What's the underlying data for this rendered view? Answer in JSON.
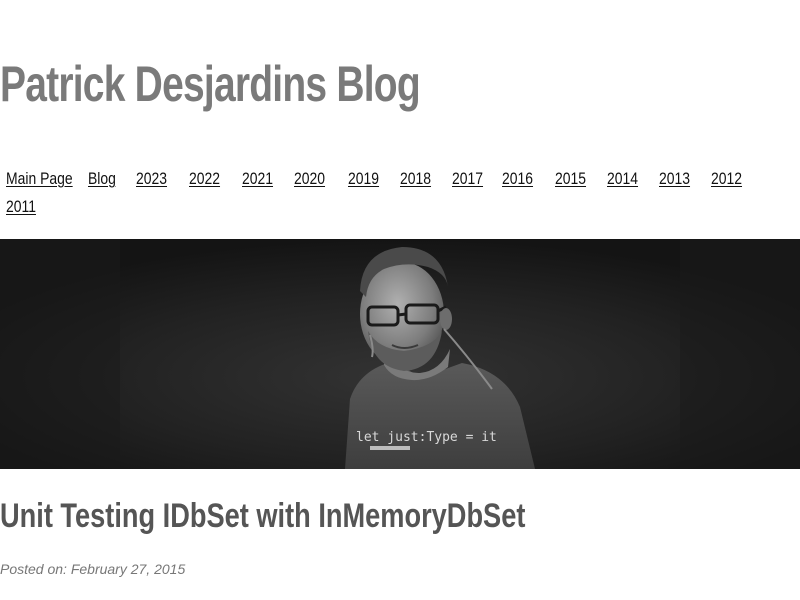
{
  "header": {
    "site_title": "Patrick Desjardins Blog"
  },
  "nav": {
    "items": [
      {
        "label": "Main Page"
      },
      {
        "label": "Blog"
      },
      {
        "label": "2023"
      },
      {
        "label": "2022"
      },
      {
        "label": "2021"
      },
      {
        "label": "2020"
      },
      {
        "label": "2019"
      },
      {
        "label": "2018"
      },
      {
        "label": "2017"
      },
      {
        "label": "2016"
      },
      {
        "label": "2015"
      },
      {
        "label": "2014"
      },
      {
        "label": "2013"
      },
      {
        "label": "2012"
      },
      {
        "label": "2011"
      }
    ]
  },
  "hero": {
    "shirt_text": "let just:Type = it"
  },
  "post": {
    "title": "Unit Testing IDbSet with InMemoryDbSet",
    "posted_on": "Posted on: February 27, 2015"
  },
  "colors": {
    "title": "#7a7a7a",
    "link": "#111111",
    "hero_bg": "#1e1e1e"
  }
}
